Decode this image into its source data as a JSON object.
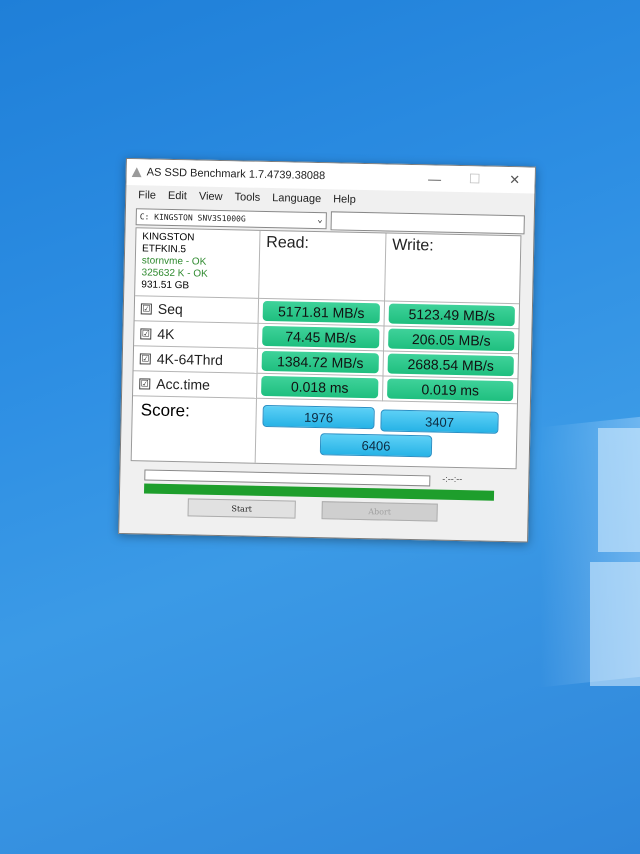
{
  "window": {
    "title": "AS SSD Benchmark 1.7.4739.38088",
    "controls": {
      "minimize": "—",
      "maximize": "☐",
      "close": "✕"
    }
  },
  "menu": [
    "File",
    "Edit",
    "View",
    "Tools",
    "Language",
    "Help"
  ],
  "drive": {
    "selected": "C: KINGSTON SNV3S1000G",
    "chevron": "⌄"
  },
  "info": {
    "model": "KINGSTON",
    "firmware": "ETFKIN.5",
    "driver": "stornvme - OK",
    "alignment": "325632 K - OK",
    "size": "931.51 GB"
  },
  "headers": {
    "read": "Read:",
    "write": "Write:"
  },
  "tests": [
    {
      "label": "Seq",
      "checked": "☑",
      "read": "5171.81 MB/s",
      "write": "5123.49 MB/s"
    },
    {
      "label": "4K",
      "checked": "☑",
      "read": "74.45 MB/s",
      "write": "206.05 MB/s"
    },
    {
      "label": "4K-64Thrd",
      "checked": "☑",
      "read": "1384.72 MB/s",
      "write": "2688.54 MB/s"
    },
    {
      "label": "Acc.time",
      "checked": "☑",
      "read": "0.018 ms",
      "write": "0.019 ms"
    }
  ],
  "score": {
    "label": "Score:",
    "read": "1976",
    "write": "3407",
    "total": "6406"
  },
  "progress": {
    "timer": "-:--:--",
    "complete_fraction": 1.0
  },
  "buttons": {
    "start": "Start",
    "abort": "Abort"
  },
  "colors": {
    "result_green": "#1fbf7f",
    "score_blue": "#27b3e6",
    "progress_green": "#1e9e2c",
    "desktop_blue": "#2d8ee3"
  }
}
